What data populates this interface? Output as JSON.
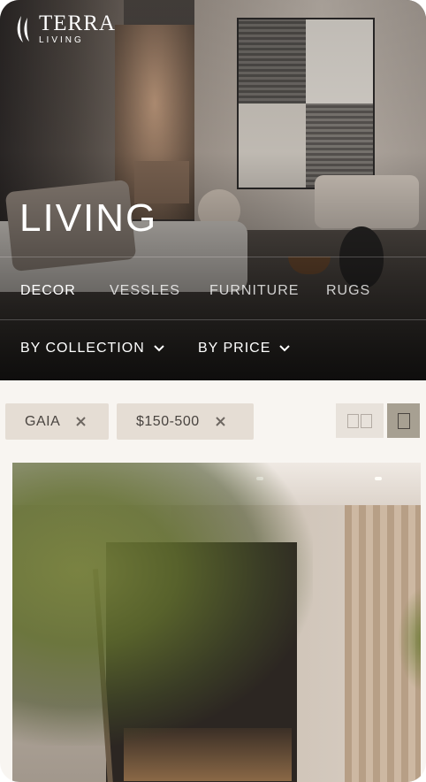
{
  "brand": {
    "name": "TERRA",
    "tagline": "LIVING"
  },
  "hero": {
    "title": "LIVING"
  },
  "categories": [
    {
      "label": "DECOR",
      "active": true
    },
    {
      "label": "VESSLES",
      "active": false
    },
    {
      "label": "FURNITURE",
      "active": false
    },
    {
      "label": "RUGS",
      "active": false
    }
  ],
  "filters": {
    "collection_label": "BY COLLECTION",
    "price_label": "BY PRICE"
  },
  "active_filters": [
    {
      "label": "GAIA"
    },
    {
      "label": "$150-500"
    }
  ],
  "view_modes": {
    "selected": "single",
    "options": [
      "grid",
      "single"
    ]
  },
  "icons": {
    "logo": "terra-leaf-logo-icon",
    "dropdown": "chevron-down-icon",
    "remove": "close-icon",
    "grid_view": "grid-view-icon",
    "single_view": "single-view-icon"
  },
  "colors": {
    "background": "#f8f5f1",
    "chip": "#e5ddd4",
    "chip_text": "#494440",
    "view_selected": "#a7a092",
    "view_unselected": "#e8e2db"
  }
}
